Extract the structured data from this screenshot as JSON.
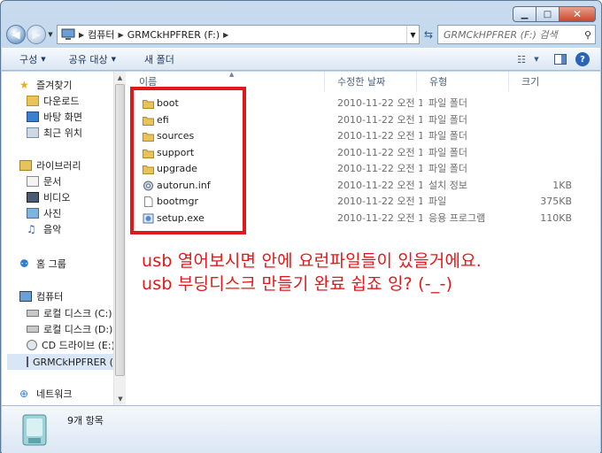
{
  "window": {
    "caption": {
      "minimize": "▁",
      "maximize": "□",
      "close": "✕"
    }
  },
  "address_bar": {
    "crumbs": [
      "컴퓨터",
      "GRMCkHPFRER (F:)"
    ],
    "search_placeholder": "GRMCkHPFRER (F:) 검색"
  },
  "toolbar": {
    "organize": "구성",
    "share_with": "공유 대상",
    "new_folder": "새 폴더"
  },
  "nav_pane": {
    "favorites": {
      "label": "즐겨찾기",
      "items": [
        "다운로드",
        "바탕 화면",
        "최근 위치"
      ]
    },
    "libraries": {
      "label": "라이브러리",
      "items": [
        "문서",
        "비디오",
        "사진",
        "음악"
      ]
    },
    "homegroup": "홈 그룹",
    "computer": {
      "label": "컴퓨터",
      "items": [
        "로컬 디스크 (C:)",
        "로컬 디스크 (D:)",
        "CD 드라이브 (E:)",
        "GRMCkHPFRER (F:)"
      ]
    },
    "network": "네트워크"
  },
  "columns": {
    "name": "이름",
    "date": "수정한 날짜",
    "type": "유형",
    "size": "크기"
  },
  "files": [
    {
      "name": "boot",
      "date": "2010-11-22 오전 1...",
      "type": "파일 폴더",
      "size": "",
      "icon": "folder"
    },
    {
      "name": "efi",
      "date": "2010-11-22 오전 1...",
      "type": "파일 폴더",
      "size": "",
      "icon": "folder"
    },
    {
      "name": "sources",
      "date": "2010-11-22 오전 1...",
      "type": "파일 폴더",
      "size": "",
      "icon": "folder"
    },
    {
      "name": "support",
      "date": "2010-11-22 오전 1...",
      "type": "파일 폴더",
      "size": "",
      "icon": "folder"
    },
    {
      "name": "upgrade",
      "date": "2010-11-22 오전 1...",
      "type": "파일 폴더",
      "size": "",
      "icon": "folder"
    },
    {
      "name": "autorun.inf",
      "date": "2010-11-22 오전 1...",
      "type": "설치 정보",
      "size": "1KB",
      "icon": "settings-file"
    },
    {
      "name": "bootmgr",
      "date": "2010-11-22 오전 1...",
      "type": "파일",
      "size": "375KB",
      "icon": "blank-file"
    },
    {
      "name": "setup.exe",
      "date": "2010-11-22 오전 1...",
      "type": "응용 프로그램",
      "size": "110KB",
      "icon": "setup-exe"
    }
  ],
  "annotation": {
    "line1": "usb 열어보시면 안에 요런파일들이 있을거에요.",
    "line2": "usb 부딩디스크 만들기 완료 쉽죠 잉? (-_-)",
    "color": "#e0181b"
  },
  "details": {
    "item_count": "9개 항목"
  }
}
